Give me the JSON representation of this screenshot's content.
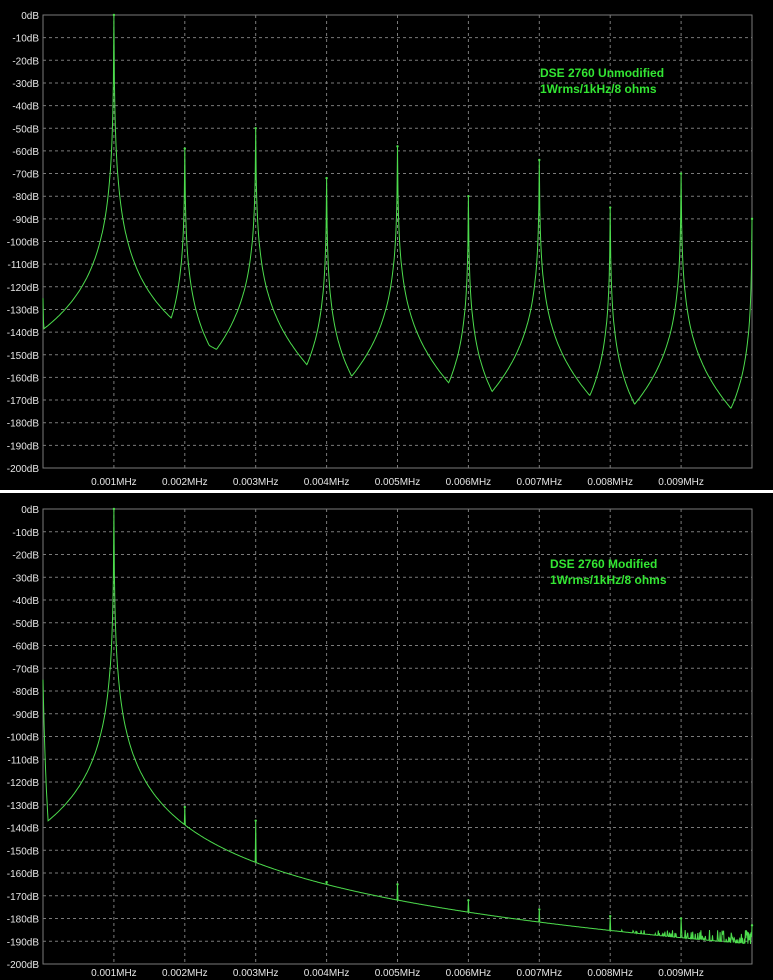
{
  "chart_data": [
    {
      "type": "line",
      "title": "",
      "xlabel": "",
      "ylabel": "",
      "xlim": [
        0,
        0.01
      ],
      "ylim": [
        -200,
        0
      ],
      "grid": true,
      "x_ticks": [
        "0.001MHz",
        "0.002MHz",
        "0.003MHz",
        "0.004MHz",
        "0.005MHz",
        "0.006MHz",
        "0.007MHz",
        "0.008MHz",
        "0.009MHz"
      ],
      "y_ticks": [
        "0dB",
        "-10dB",
        "-20dB",
        "-30dB",
        "-40dB",
        "-50dB",
        "-60dB",
        "-70dB",
        "-80dB",
        "-90dB",
        "-100dB",
        "-110dB",
        "-120dB",
        "-130dB",
        "-140dB",
        "-150dB",
        "-160dB",
        "-170dB",
        "-180dB",
        "-190dB",
        "-200dB"
      ],
      "annotation": [
        "DSE 2760 Unmodified",
        "1Wrms/1kHz/8 ohms"
      ],
      "noise_floor_db": -190,
      "series": [
        {
          "peaks": [
            {
              "x": 0.001,
              "y": 0
            },
            {
              "x": 0.002,
              "y": -59
            },
            {
              "x": 0.003,
              "y": -50
            },
            {
              "x": 0.004,
              "y": -72
            },
            {
              "x": 0.005,
              "y": -58
            },
            {
              "x": 0.006,
              "y": -80
            },
            {
              "x": 0.007,
              "y": -64
            },
            {
              "x": 0.008,
              "y": -85
            },
            {
              "x": 0.009,
              "y": -70
            },
            {
              "x": 0.01,
              "y": -90
            }
          ]
        }
      ]
    },
    {
      "type": "line",
      "title": "",
      "xlabel": "",
      "ylabel": "",
      "xlim": [
        0,
        0.01
      ],
      "ylim": [
        -200,
        0
      ],
      "grid": true,
      "x_ticks": [
        "0.001MHz",
        "0.002MHz",
        "0.003MHz",
        "0.004MHz",
        "0.005MHz",
        "0.006MHz",
        "0.007MHz",
        "0.008MHz",
        "0.009MHz"
      ],
      "y_ticks": [
        "0dB",
        "-10dB",
        "-20dB",
        "-30dB",
        "-40dB",
        "-50dB",
        "-60dB",
        "-70dB",
        "-80dB",
        "-90dB",
        "-100dB",
        "-110dB",
        "-120dB",
        "-130dB",
        "-140dB",
        "-150dB",
        "-160dB",
        "-170dB",
        "-180dB",
        "-190dB",
        "-200dB"
      ],
      "annotation": [
        "DSE 2760 Modified",
        "1Wrms/1kHz/8 ohms"
      ],
      "noise_floor_db": -192,
      "series": [
        {
          "peaks": [
            {
              "x": 0.001,
              "y": 0
            },
            {
              "x": 0.002,
              "y": -131
            },
            {
              "x": 0.003,
              "y": -137
            },
            {
              "x": 0.004,
              "y": -164
            },
            {
              "x": 0.005,
              "y": -165
            },
            {
              "x": 0.006,
              "y": -172
            },
            {
              "x": 0.007,
              "y": -176
            },
            {
              "x": 0.008,
              "y": -179
            },
            {
              "x": 0.009,
              "y": -180
            },
            {
              "x": 0.01,
              "y": -183
            }
          ]
        }
      ]
    }
  ],
  "colors": {
    "background": "#000000",
    "trace": "#4ddc4d",
    "grid": "#7a7a7a",
    "axis_text": "#e6e6e6",
    "annotation_text": "#33e633"
  }
}
